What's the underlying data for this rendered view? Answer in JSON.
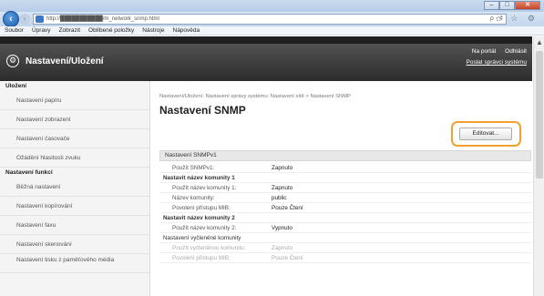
{
  "browser": {
    "address": "http://███████████/m_network_snmp.html",
    "address_right": "ρ - ¢",
    "nav_icons": "⌂ ☆ ⚙",
    "menu": [
      "Soubor",
      "Úpravy",
      "Zobrazit",
      "Oblíbené položky",
      "Nástroje",
      "Nápověda"
    ]
  },
  "header": {
    "title": "Nastavení/Uložení",
    "links": [
      "Na portál",
      "Odhlásit"
    ],
    "link2": "Poslat správci systému"
  },
  "sidebar": {
    "section1": "Uložení",
    "items1": [
      "Nastavení papíru",
      "Nastavení zobrazení",
      "Nastavení časovače"
    ],
    "item_alarm": "Ožádění hlasitosti zvuku",
    "section2": "Nastavení funkcí",
    "items2": [
      "Běžná nastavení",
      "Nastavení kopírování",
      "Nastavení faxu",
      "Nastavení skenování",
      "Nastavení tisku z paměťového média"
    ]
  },
  "main": {
    "breadcrumb": "Nastavení/Uložení: Nastavení správy systému: Nastavení sítě > Nastavení SNMP",
    "title": "Nastavení SNMP",
    "edit_label": "Editovat...",
    "section": "Nastavení SNMPv1",
    "rows": [
      {
        "label": "Použít SNMPv1:",
        "value": "Zapnuto"
      },
      {
        "label": "Nastavit název komunity 1",
        "value": ""
      },
      {
        "label": "Použít název komunity 1:",
        "value": "Zapnuto"
      },
      {
        "label": "Název komunity:",
        "value": "public"
      },
      {
        "label": "Povolení přístupu MIB:",
        "value": "Pouze Čtení"
      },
      {
        "label": "Nastavit název komunity 2",
        "value": ""
      },
      {
        "label": "Použít název komunity 2:",
        "value": "Vypnuto"
      },
      {
        "label": "Nastavení vyčleněné komunity",
        "value": ""
      },
      {
        "label": "Použít vyčleněnou komunitu:",
        "value": "Zapnuto"
      },
      {
        "label": "Povolení přístupu MIB:",
        "value": "Pouze Čtení"
      }
    ]
  }
}
